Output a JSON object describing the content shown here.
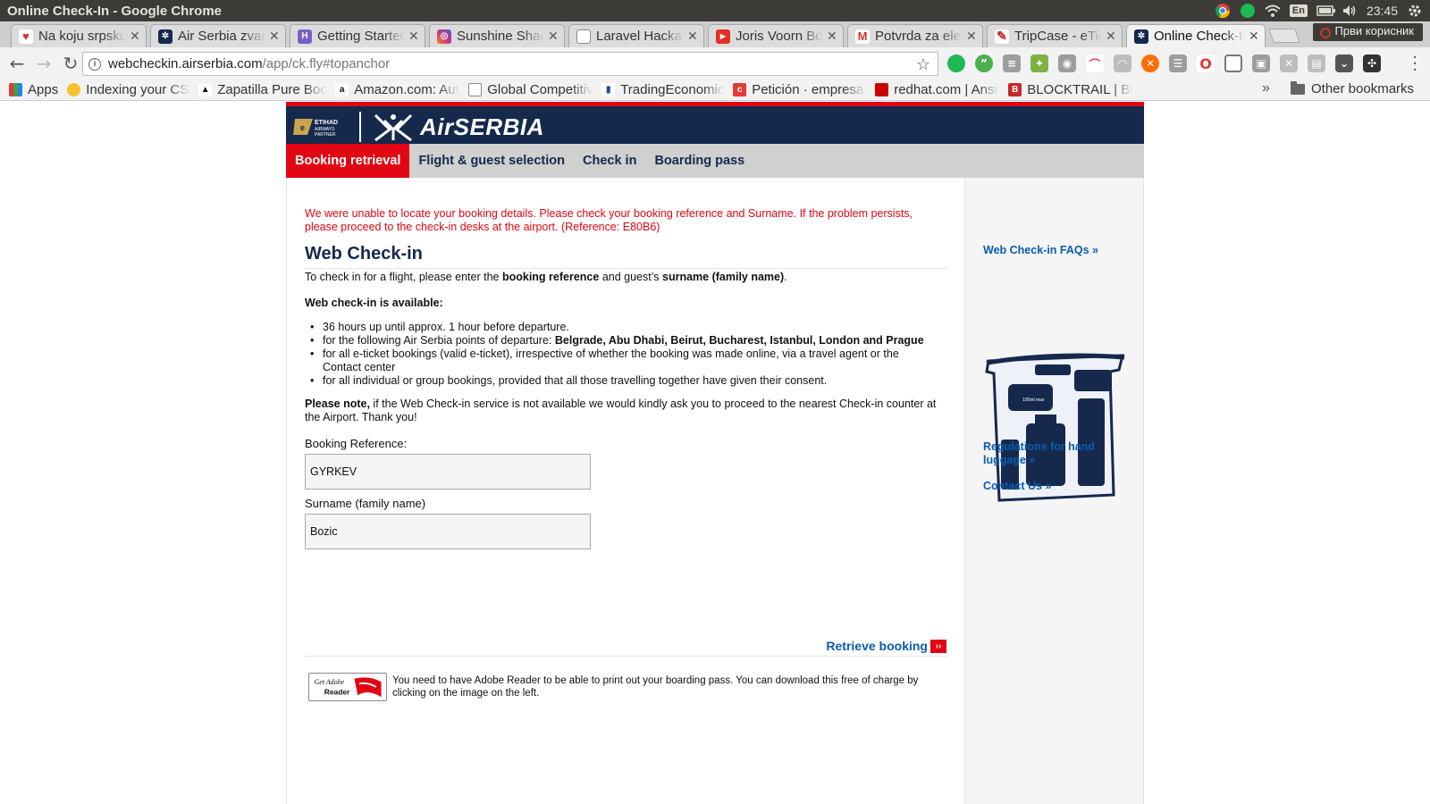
{
  "os": {
    "window_title": "Online Check-In - Google Chrome",
    "keyboard_layout": "En",
    "clock": "23:45"
  },
  "tabs": [
    {
      "label": "Na koju srpsku",
      "icon": "heart-icon",
      "color": "#d32f2f"
    },
    {
      "label": "Air Serbia zvanični",
      "icon": "airserbia-icon",
      "color": "#15294d"
    },
    {
      "label": "Getting Started",
      "icon": "heroku-icon",
      "color": "#7b5fc7"
    },
    {
      "label": "Sunshine Shades",
      "icon": "instagram-icon",
      "color": "#c13584"
    },
    {
      "label": "Laravel Hackathon",
      "icon": "page-icon",
      "color": "#888888"
    },
    {
      "label": "Joris Voorn Boiler",
      "icon": "youtube-icon",
      "color": "#e52d27"
    },
    {
      "label": "Potvrda za elektronsku",
      "icon": "gmail-icon",
      "color": "#d93025"
    },
    {
      "label": "TripCase - eTicket",
      "icon": "tripcase-icon",
      "color": "#c62828"
    },
    {
      "label": "Online Check-In",
      "icon": "airserbia-icon",
      "color": "#15294d",
      "active": true
    }
  ],
  "user_chip": "Први корисник",
  "toolbar": {
    "url_host": "webcheckin.airserbia.com",
    "url_path": "/app/ck.fly#topanchor"
  },
  "bookmarks": [
    {
      "label": "Apps",
      "icon": "apps-grid-icon"
    },
    {
      "label": "Indexing your CSV",
      "icon": "flower-icon"
    },
    {
      "label": "Zapatilla Pure Boost",
      "icon": "adidas-icon"
    },
    {
      "label": "Amazon.com: Auto",
      "icon": "amazon-icon"
    },
    {
      "label": "Global Competitiveness",
      "icon": "page-icon"
    },
    {
      "label": "TradingEconomics",
      "icon": "bar-chart-icon"
    },
    {
      "label": "Petición · empresa",
      "icon": "change-org-icon"
    },
    {
      "label": "redhat.com | Ansible",
      "icon": "redhat-icon"
    },
    {
      "label": "BLOCKTRAIL | Bitcoin",
      "icon": "blocktrail-icon"
    }
  ],
  "bookmarks_other": "Other bookmarks",
  "site": {
    "brand_text": "AirSERBIA",
    "partner_text": "ETIHAD AIRWAYS PARTNER",
    "nav": [
      {
        "label": "Booking retrieval",
        "active": true
      },
      {
        "label": "Flight & guest selection",
        "active": false
      },
      {
        "label": "Check in",
        "active": false
      },
      {
        "label": "Boarding pass",
        "active": false
      }
    ],
    "error_message": "We were unable to locate your booking details. Please check your booking reference and Surname. If the problem persists, please proceed to the check-in desks at the airport. (Reference: E80B6)",
    "title": "Web Check-in",
    "intro_prefix": "To check in for a flight, please enter the ",
    "intro_bold1": "booking reference",
    "intro_mid": " and guest’s ",
    "intro_bold2": "surname (family name)",
    "intro_suffix": ".",
    "availability_heading": "Web check-in is available:",
    "bullet1": "36 hours up until approx. 1 hour before departure.",
    "bullet2_prefix": "for the following Air Serbia points of departure: ",
    "bullet2_bold": "Belgrade, Abu Dhabi, Beirut, Bucharest, Istanbul, London and Prague",
    "bullet3": "for all e-ticket bookings (valid e-ticket), irrespective of whether the booking was made online, via a travel agent or the Contact center",
    "bullet4": "for all individual or group bookings, provided that all those travelling together have given their consent.",
    "note_bold": "Please note,",
    "note_text": " if the Web Check-in service is not available we would kindly ask you to proceed to the nearest Check-in counter at the Airport. Thank you!",
    "booking_ref_label": "Booking Reference:",
    "booking_ref_value": "GYRKEV",
    "surname_label": "Surname (family name)",
    "surname_value": "Bozic",
    "retrieve_label": "Retrieve booking",
    "adobe_badge_get": "Get Adobe",
    "adobe_badge_reader": "Reader",
    "adobe_text": "You need to have Adobe Reader to be able to print out your boarding pass. You can download this free of charge by clicking on the image on the left.",
    "sidebar_faq": "Web Check-in FAQs »",
    "sidebar_regulations": "Regulations for hand luggage »",
    "sidebar_contact": "Contact Us »",
    "luggage_label": "100ml max"
  },
  "colors": {
    "brand_navy": "#15294d",
    "brand_red": "#e20613",
    "link_blue": "#0a5caf"
  }
}
